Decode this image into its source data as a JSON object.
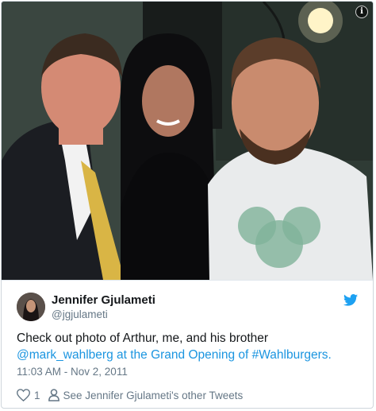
{
  "tweet": {
    "author_name": "Jennifer Gjulameti",
    "author_handle": "@jgjulameti",
    "text_before": "Check out photo of Arthur, me, and his brother",
    "text_middle": "@mark_wahlberg at the Grand Opening of ",
    "hashtag": "#Wahlburgers.",
    "timestamp": "11:03 AM - Nov 2, 2011",
    "like_count": "1",
    "other_tweets_label": "See Jennifer Gjulameti's other Tweets"
  },
  "icons": {
    "info": "info-icon",
    "bird": "twitter-bird-icon",
    "like": "heart-icon",
    "profile": "person-icon"
  },
  "colors": {
    "link": "#1b95e0",
    "muted": "#657786",
    "text": "#14171a",
    "border": "#cfd6dc"
  }
}
